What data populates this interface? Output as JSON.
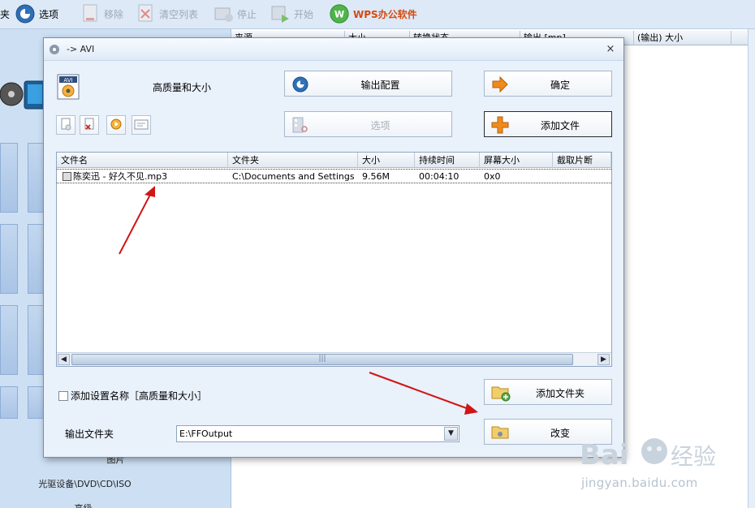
{
  "toolbar": {
    "items": [
      {
        "label": "夹"
      },
      {
        "label": "选项"
      },
      {
        "label": "移除"
      },
      {
        "label": "清空列表"
      },
      {
        "label": "停止"
      },
      {
        "label": "开始"
      },
      {
        "label": "WPS办公软件"
      }
    ]
  },
  "left_panel": {
    "labels": [
      "图片",
      "光驱设备\\DVD\\CD\\ISO",
      "高级"
    ]
  },
  "right_grid": {
    "columns": [
      "来源",
      "大小",
      "转换状态",
      "输出 [mp]",
      "(输出) 大小"
    ]
  },
  "dialog": {
    "title": "-> AVI",
    "close": "×",
    "profile_name": "高质量和大小",
    "buttons": {
      "output_config": "输出配置",
      "ok": "确定",
      "options": "选项",
      "add_file": "添加文件",
      "add_folder": "添加文件夹",
      "change": "改变"
    },
    "file_list": {
      "columns": [
        "文件名",
        "文件夹",
        "大小",
        "持续时间",
        "屏幕大小",
        "截取片断"
      ],
      "rows": [
        {
          "name": "陈奕迅 - 好久不见.mp3",
          "folder": "C:\\Documents and Settings\\...",
          "size": "9.56M",
          "duration": "00:04:10",
          "screen": "0x0",
          "clip": ""
        }
      ]
    },
    "append_setting_label": "添加设置名称［高质量和大小］",
    "output_folder_label": "输出文件夹",
    "output_folder_value": "E:\\FFOutput"
  },
  "watermark": {
    "text": "jingyan.baidu.com"
  },
  "colors": {
    "accent_orange": "#f08a1c",
    "arrow_red": "#d01515",
    "wps_orange": "#d54a10"
  }
}
